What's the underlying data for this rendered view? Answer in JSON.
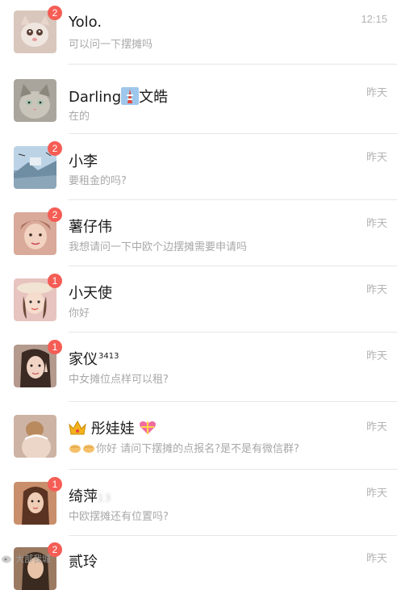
{
  "chats": [
    {
      "name": "Yolo.",
      "preview": "可以问一下摆摊吗",
      "time": "12:15",
      "badge": "2",
      "avatar_icon": "cat-avatar",
      "avatar_color": "#d9c7bd"
    },
    {
      "name": "Darling",
      "name_emoji": "tower-emoji",
      "name_suffix": "文皓",
      "preview": "在的",
      "time": "昨天",
      "badge": "",
      "avatar_icon": "kitten-avatar",
      "avatar_color": "#a9a59c"
    },
    {
      "name": "小李",
      "preview": "要租金的吗?",
      "time": "昨天",
      "badge": "2",
      "avatar_icon": "landscape-avatar",
      "avatar_color": "#bcd3e6"
    },
    {
      "name": "薯仔伟",
      "preview": "我想请问一下中欧个边摆摊需要申请吗",
      "time": "昨天",
      "badge": "2",
      "avatar_icon": "girl-avatar",
      "avatar_color": "#d9a999"
    },
    {
      "name": "小天使",
      "preview": "你好",
      "time": "昨天",
      "badge": "1",
      "avatar_icon": "girl-hat-avatar",
      "avatar_color": "#e7c4bf"
    },
    {
      "name": "家仪",
      "name_sup": "3413",
      "preview": "中女摊位点样可以租?",
      "time": "昨天",
      "badge": "1",
      "avatar_icon": "girl-peace-avatar",
      "avatar_color": "#b39a8d"
    },
    {
      "name": "彤娃娃",
      "name_prefix_emoji": "crown-emoji",
      "name_suffix_emoji": "gift-heart-emoji",
      "preview": "你好 请问下摆摊的点报名?是不是有微信群?",
      "preview_prefix_emoji": "hands-emoji",
      "time": "昨天",
      "badge": "",
      "avatar_icon": "bride-avatar",
      "avatar_color": "#cdb3a4"
    },
    {
      "name": "绮萍",
      "name_blurred": "13",
      "preview": "中欧摆摊还有位置吗?",
      "time": "昨天",
      "badge": "1",
      "avatar_icon": "girl-long-hair-avatar",
      "avatar_color": "#c98f6c"
    },
    {
      "name": "贰玲",
      "preview": "",
      "time": "昨天",
      "badge": "2",
      "avatar_icon": "girl-dark-avatar",
      "avatar_color": "#9b7a62"
    }
  ],
  "watermark": "大部我城",
  "colors": {
    "badge": "#f55d55",
    "name": "#1a1a1a",
    "preview": "#a8a8a8",
    "time": "#b3b3b3",
    "divider": "#e6e6e6"
  }
}
